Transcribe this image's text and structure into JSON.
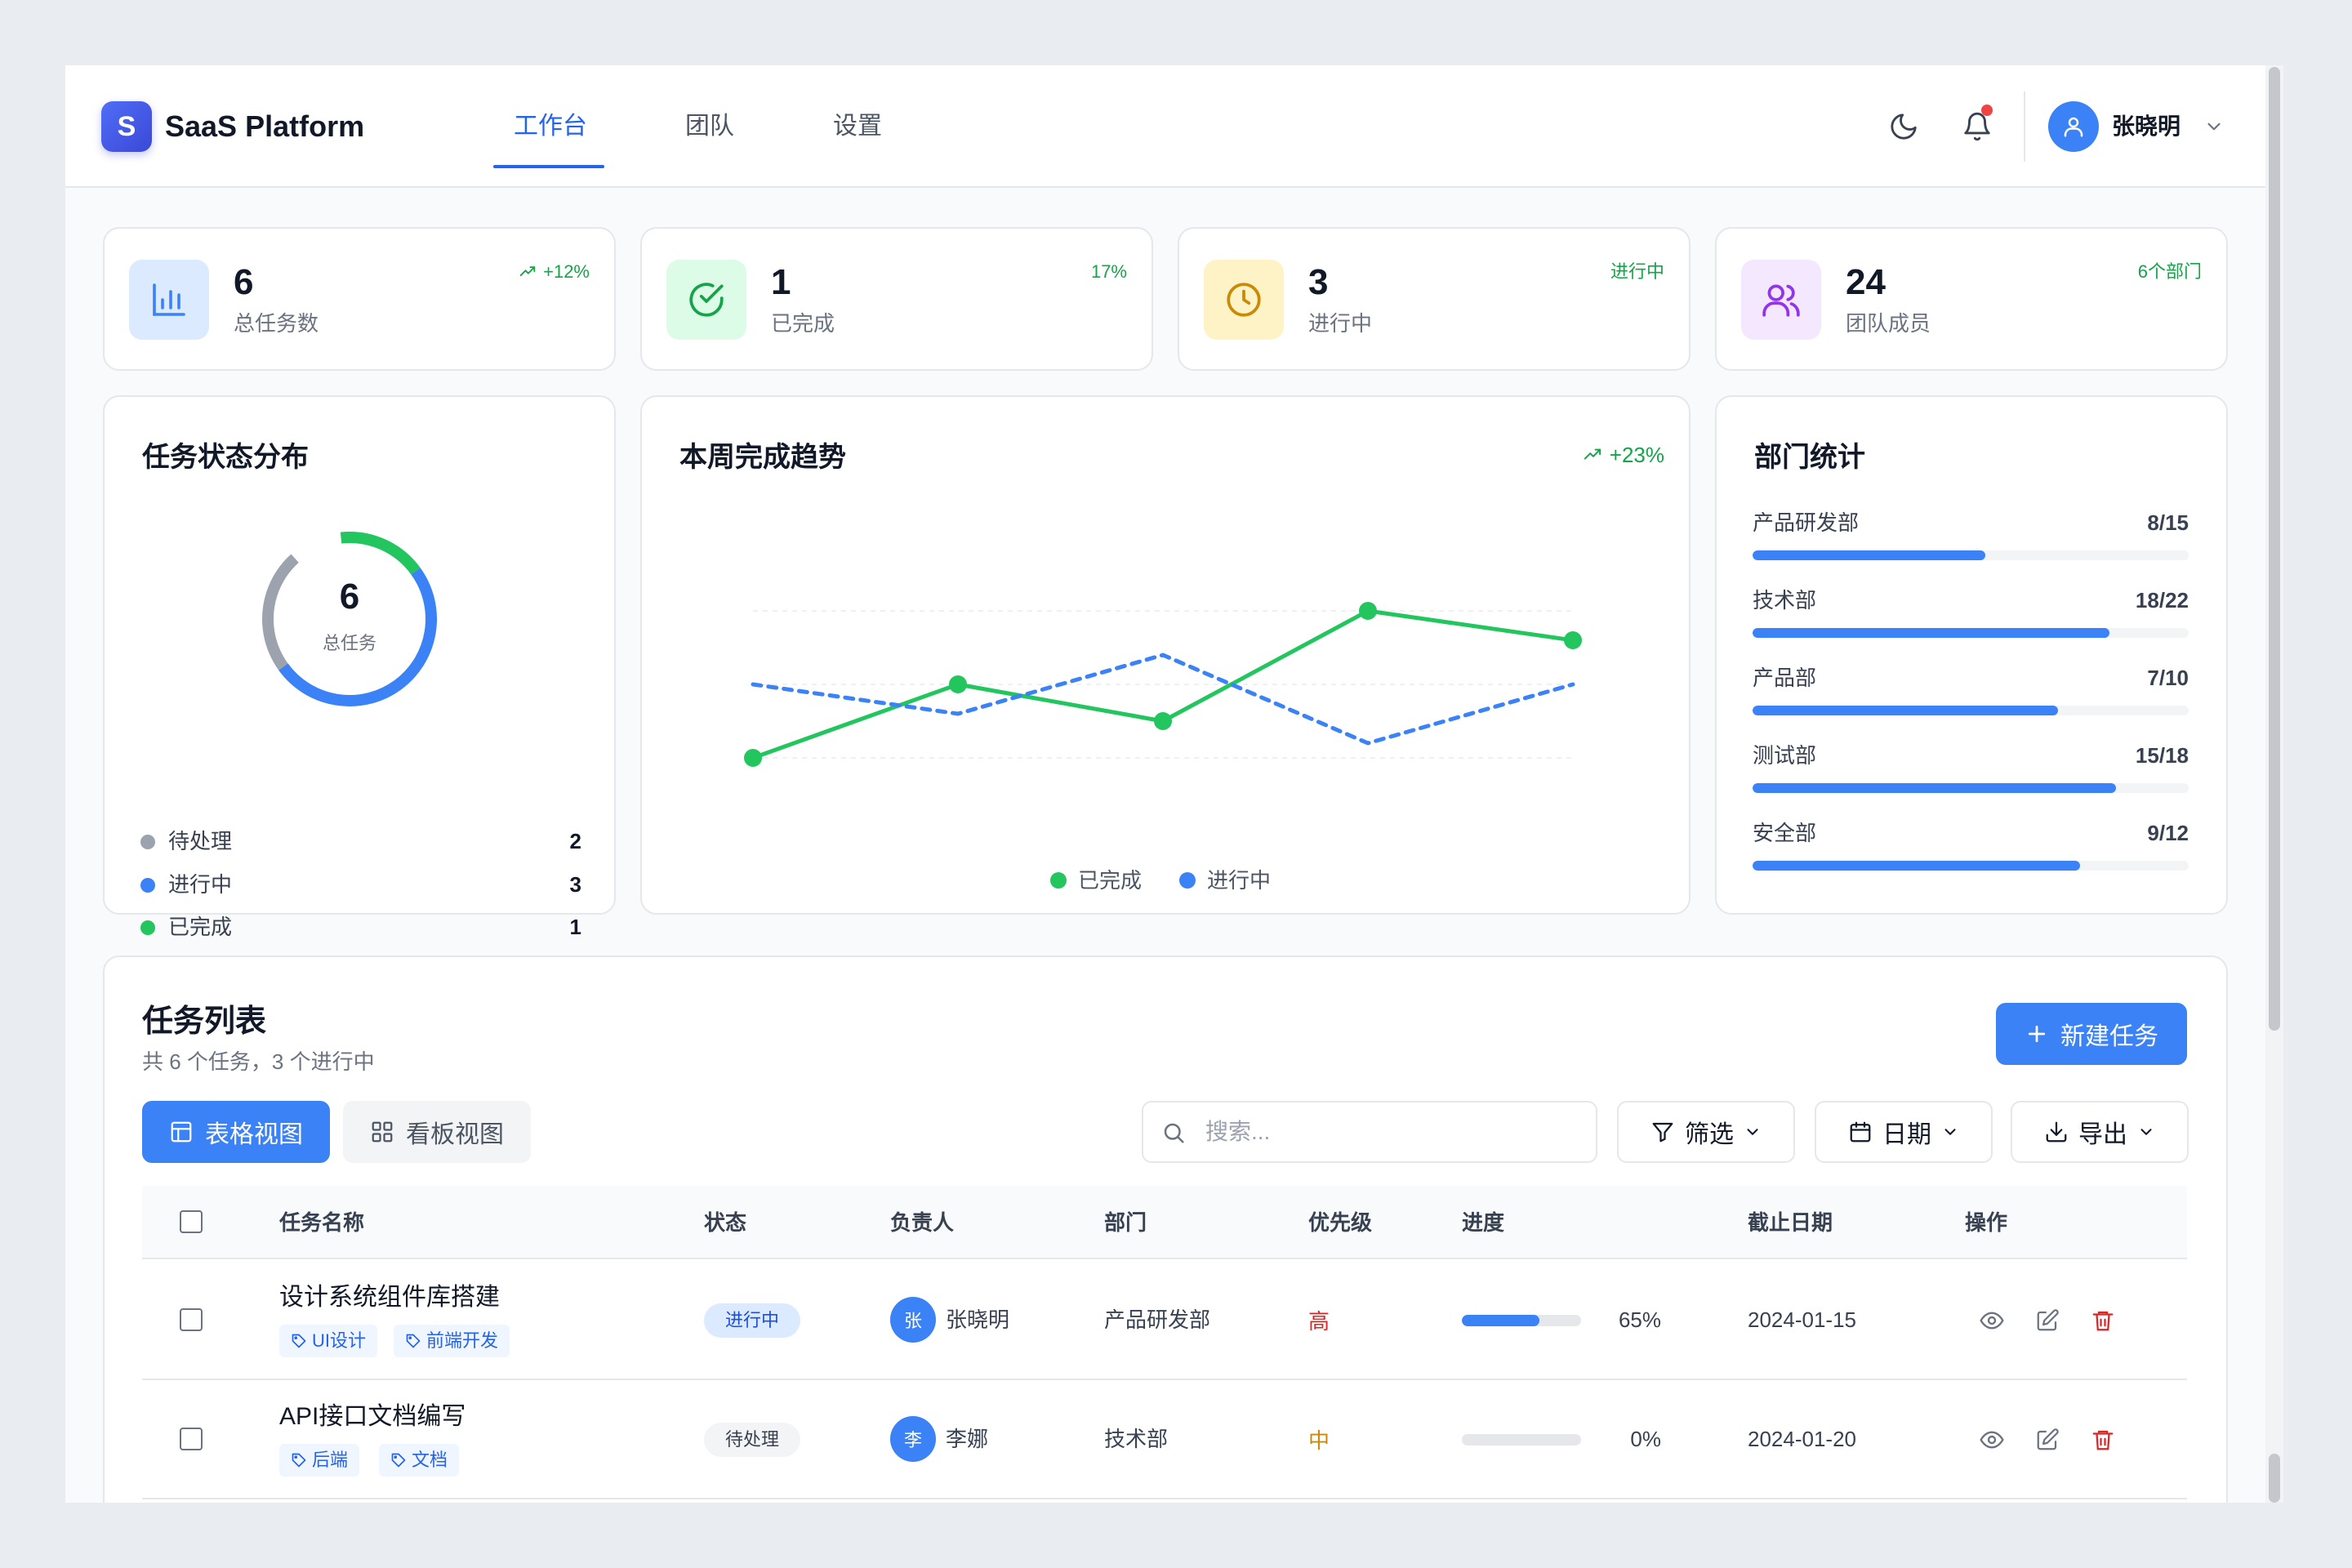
{
  "header": {
    "logo_letter": "S",
    "app_name": "SaaS Platform",
    "tabs": [
      {
        "label": "工作台",
        "active": true
      },
      {
        "label": "团队",
        "active": false
      },
      {
        "label": "设置",
        "active": false
      }
    ],
    "icons": [
      "moon-icon",
      "bell-icon",
      "user-icon",
      "chevron-down-icon"
    ],
    "user_name": "张晓明"
  },
  "stats": [
    {
      "value": "6",
      "label": "总任务数",
      "badge": "+12%",
      "icon": "bar-chart-icon",
      "icon_bg": "#dbeafe",
      "icon_color": "#3b82f6"
    },
    {
      "value": "1",
      "label": "已完成",
      "badge": "17%",
      "icon": "check-circle-icon",
      "icon_bg": "#dcfce7",
      "icon_color": "#16a34a"
    },
    {
      "value": "3",
      "label": "进行中",
      "badge": "进行中",
      "icon": "clock-icon",
      "icon_bg": "#fef3c7",
      "icon_color": "#ca8a04"
    },
    {
      "value": "24",
      "label": "团队成员",
      "badge": "6个部门",
      "icon": "users-icon",
      "icon_bg": "#f3e8ff",
      "icon_color": "#9333ea"
    }
  ],
  "status_card": {
    "title": "任务状态分布",
    "center_value": "6",
    "center_label": "总任务",
    "legend": [
      {
        "label": "待处理",
        "value": 2,
        "color": "#9ca3af"
      },
      {
        "label": "进行中",
        "value": 3,
        "color": "#3b82f6"
      },
      {
        "label": "已完成",
        "value": 1,
        "color": "#22c55e"
      }
    ]
  },
  "trend_card": {
    "title": "本周完成趋势",
    "badge": "+23%"
  },
  "chart_data": {
    "type": "line",
    "title": "本周完成趋势",
    "x_points": 5,
    "series": [
      {
        "name": "已完成",
        "color": "#22c55e",
        "style": "solid",
        "values": [
          0,
          2,
          1,
          4,
          3.2
        ]
      },
      {
        "name": "进行中",
        "color": "#3b82f6",
        "style": "dashed",
        "values": [
          2,
          1.2,
          2.8,
          0.4,
          2
        ]
      }
    ],
    "ylim": [
      0,
      4
    ],
    "grid": true,
    "legend_position": "bottom"
  },
  "dept_card": {
    "title": "部门统计",
    "items": [
      {
        "name": "产品研发部",
        "value": "8/15",
        "fraction": 0.533
      },
      {
        "name": "技术部",
        "value": "18/22",
        "fraction": 0.818
      },
      {
        "name": "产品部",
        "value": "7/10",
        "fraction": 0.7
      },
      {
        "name": "测试部",
        "value": "15/18",
        "fraction": 0.833
      },
      {
        "name": "安全部",
        "value": "9/12",
        "fraction": 0.75
      }
    ]
  },
  "task_list": {
    "title": "任务列表",
    "subtitle": "共 6 个任务，3 个进行中",
    "new_button": "新建任务",
    "view_table": "表格视图",
    "view_board": "看板视图",
    "search_placeholder": "搜索...",
    "filter_label": "筛选",
    "date_label": "日期",
    "export_label": "导出",
    "columns": [
      "任务名称",
      "状态",
      "负责人",
      "部门",
      "优先级",
      "进度",
      "截止日期",
      "操作"
    ],
    "rows": [
      {
        "name": "设计系统组件库搭建",
        "tags": [
          "UI设计",
          "前端开发"
        ],
        "status": "进行中",
        "status_bg": "#dbeafe",
        "status_color": "#1d4ed8",
        "assignee_initial": "张",
        "assignee": "张晓明",
        "dept": "产品研发部",
        "priority": "高",
        "priority_color": "#dc2626",
        "progress": 65,
        "progress_label": "65%",
        "due": "2024-01-15"
      },
      {
        "name": "API接口文档编写",
        "tags": [
          "后端",
          "文档"
        ],
        "status": "待处理",
        "status_bg": "#f3f4f6",
        "status_color": "#374151",
        "assignee_initial": "李",
        "assignee": "李娜",
        "dept": "技术部",
        "priority": "中",
        "priority_color": "#ca8a04",
        "progress": 0,
        "progress_label": "0%",
        "due": "2024-01-20"
      }
    ]
  }
}
